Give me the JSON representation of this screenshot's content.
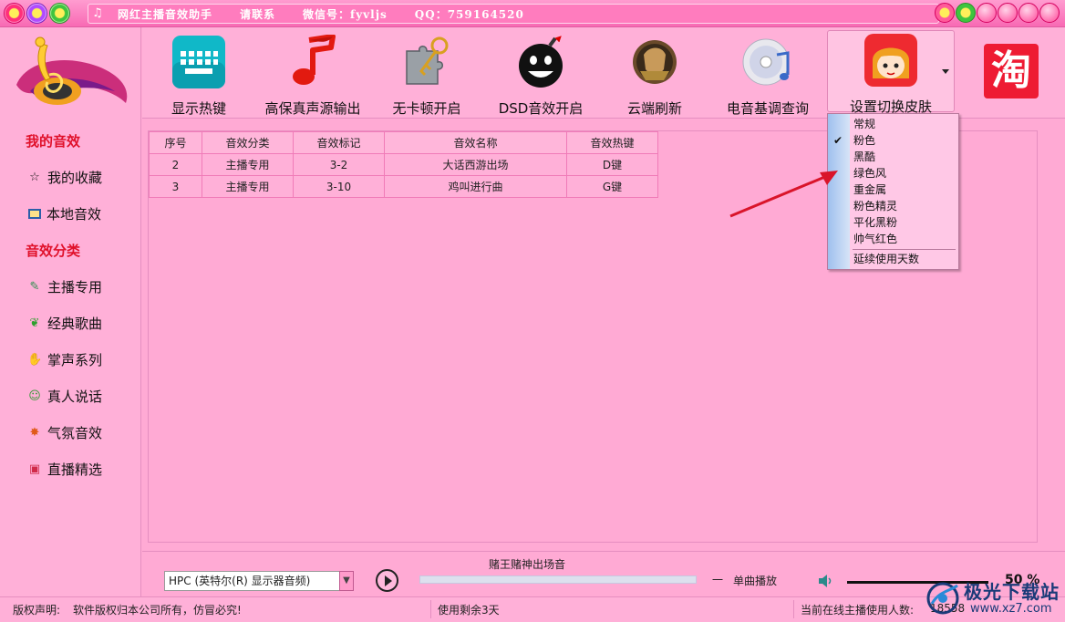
{
  "window": {
    "title": "网红主播音效助手",
    "contact": "请联系",
    "wechat": "微信号：fyvljs",
    "qq": "QQ：759164520"
  },
  "sidebar": {
    "sections": [
      {
        "label": "我的音效",
        "items": [
          {
            "label": "我的收藏",
            "icon": "star-icon"
          },
          {
            "label": "本地音效",
            "icon": "monitor-icon"
          }
        ]
      },
      {
        "label": "音效分类",
        "items": [
          {
            "label": "主播专用",
            "icon": "microphone-icon"
          },
          {
            "label": "经典歌曲",
            "icon": "leaf-icon"
          },
          {
            "label": "掌声系列",
            "icon": "hand-icon"
          },
          {
            "label": "真人说话",
            "icon": "person-icon"
          },
          {
            "label": "气氛音效",
            "icon": "firework-icon"
          },
          {
            "label": "直播精选",
            "icon": "gift-icon"
          }
        ]
      }
    ]
  },
  "toolbar": {
    "buttons": [
      {
        "label": "显示热键",
        "icon": "keyboard-icon"
      },
      {
        "label": "高保真声源输出",
        "icon": "music-note-icon"
      },
      {
        "label": "无卡顿开启",
        "icon": "puzzle-key-icon"
      },
      {
        "label": "DSD音效开启",
        "icon": "bomb-face-icon"
      },
      {
        "label": "云端刷新",
        "icon": "warrior-icon"
      },
      {
        "label": "电音基调查询",
        "icon": "cd-icon"
      },
      {
        "label": "设置切换皮肤",
        "icon": "anime-girl-icon"
      }
    ],
    "taobao_label": "淘"
  },
  "table": {
    "columns": [
      "序号",
      "音效分类",
      "音效标记",
      "音效名称",
      "音效热键"
    ],
    "rows": [
      [
        "2",
        "主播专用",
        "3-2",
        "大话西游出场",
        "D键"
      ],
      [
        "3",
        "主播专用",
        "3-10",
        "鸡叫进行曲",
        "G键"
      ]
    ]
  },
  "skin_menu": {
    "items": [
      "常规",
      "粉色",
      "黑酷",
      "绿色风",
      "重金属",
      "粉色精灵",
      "平化黑粉",
      "帅气红色"
    ],
    "checked_index": 1,
    "extra": "延续使用天数"
  },
  "player": {
    "device": "HPC (英特尔(R) 显示器音频)",
    "now_playing": "赌王赌神出场音",
    "mode_dash": "一",
    "mode": "单曲播放",
    "volume_label": "50 %",
    "progress": 0
  },
  "status": {
    "copyright_label": "版权声明:",
    "copyright_text": "软件版权归本公司所有，仿冒必究!",
    "remaining": "使用剩余3天",
    "online_label": "当前在线主播使用人数:",
    "online_count": "18558"
  },
  "watermark": {
    "line1": "极光下载站",
    "line2": "www.xz7.com"
  },
  "colors": {
    "bg": "#ffaad4",
    "title_bar": "#f86ab4",
    "category_red": "#e0102a",
    "taobao_red": "#ee1b33",
    "arrow_red": "#d9142a"
  }
}
